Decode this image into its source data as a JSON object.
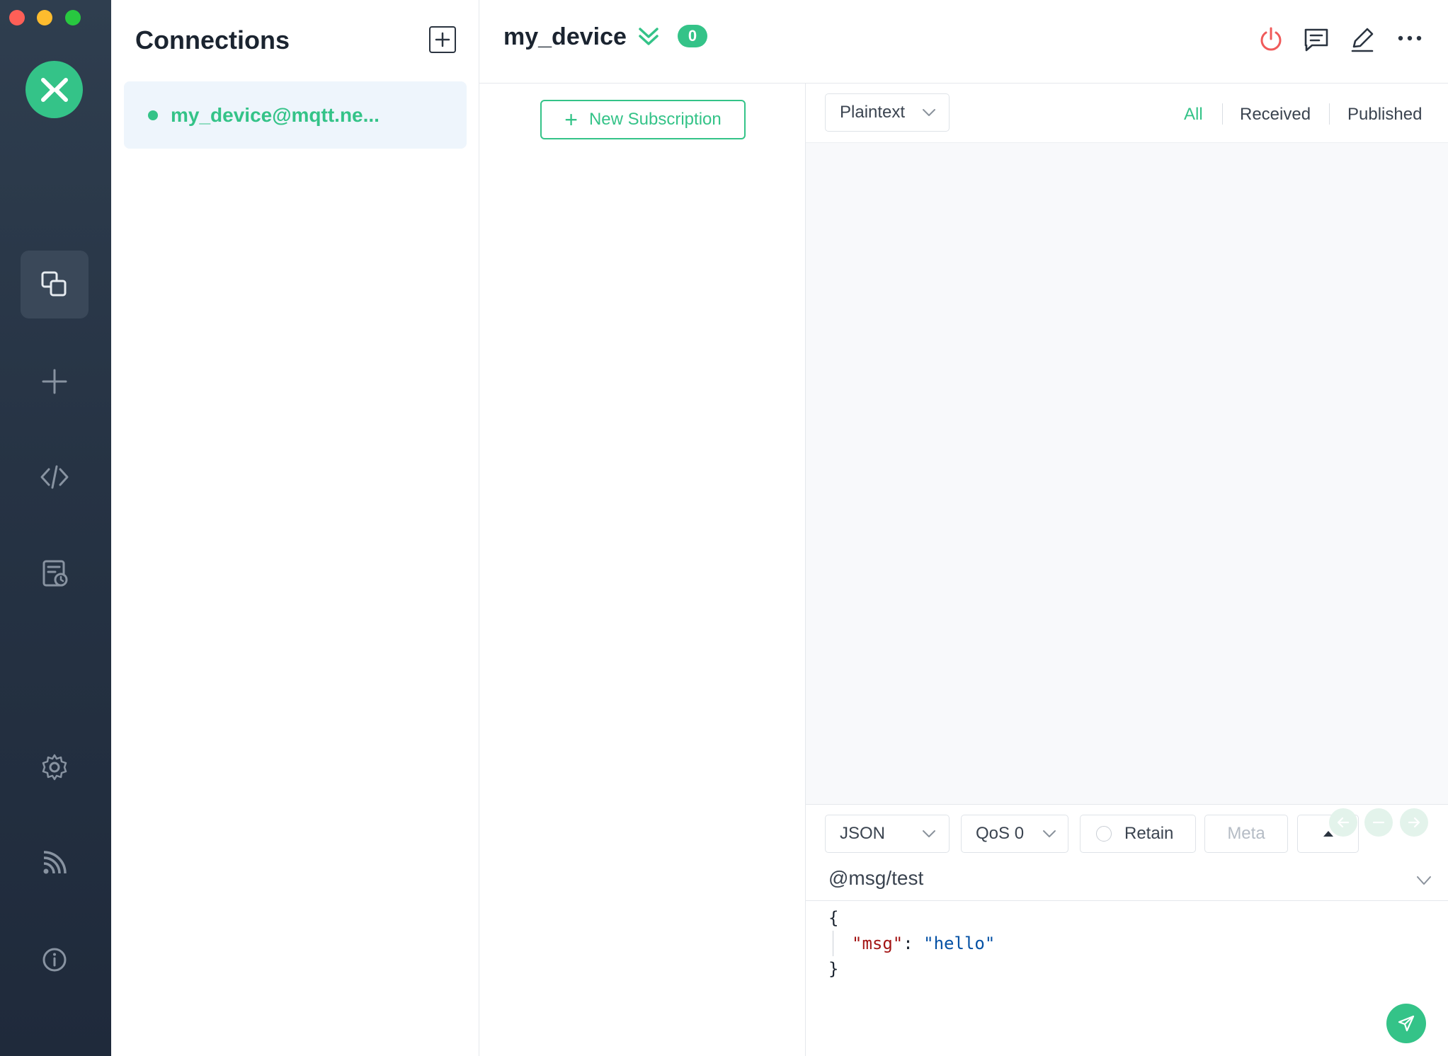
{
  "sidebar": {
    "items": [
      {
        "name": "connections",
        "icon": "copy-icon",
        "active": true
      },
      {
        "name": "new-connection",
        "icon": "plus-icon",
        "active": false
      },
      {
        "name": "script",
        "icon": "code-icon",
        "active": false
      },
      {
        "name": "log",
        "icon": "log-icon",
        "active": false
      },
      {
        "name": "settings",
        "icon": "gear-icon",
        "active": false
      },
      {
        "name": "subscribe",
        "icon": "rss-icon",
        "active": false
      },
      {
        "name": "about",
        "icon": "info-icon",
        "active": false
      }
    ]
  },
  "connections": {
    "title": "Connections",
    "items": [
      {
        "name": "my_device@mqtt.ne...",
        "status": "connected"
      }
    ]
  },
  "header": {
    "title": "my_device",
    "unread_count": "0"
  },
  "subscriptions": {
    "new_label": "New Subscription"
  },
  "messages": {
    "format": "Plaintext",
    "filters": [
      "All",
      "Received",
      "Published"
    ],
    "active_filter": "All"
  },
  "publish": {
    "payload_format": "JSON",
    "qos": "QoS 0",
    "retain_label": "Retain",
    "meta_label": "Meta",
    "topic": "@msg/test",
    "payload": {
      "open": "{",
      "key": "\"msg\"",
      "colon": ": ",
      "value": "\"hello\"",
      "close": "}"
    }
  },
  "colors": {
    "accent": "#34c388",
    "sidebar_bg": "#263344",
    "danger": "#f05a5a"
  }
}
